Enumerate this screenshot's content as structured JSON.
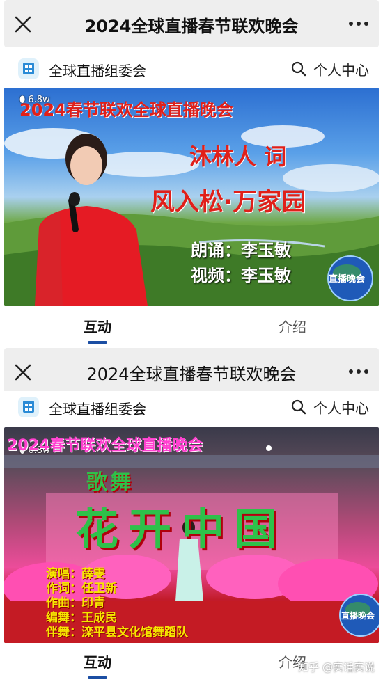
{
  "panels": [
    {
      "window_title": "2024全球直播春节联欢晚会",
      "account_name": "全球直播组委会",
      "personal_center": "个人中心",
      "video": {
        "views": "6.8w",
        "banner": "2024春节联欢全球直播晚会",
        "author": "沐林人 词",
        "work": "风入松·万家园",
        "credits": [
          "朗诵：李玉敏",
          "视频：李玉敏"
        ],
        "badge": "直播晚会"
      },
      "tabs": [
        "互动",
        "介绍"
      ]
    },
    {
      "window_title": "2024全球直播春节联欢晚会",
      "account_name": "全球直播组委会",
      "personal_center": "个人中心",
      "video": {
        "views": "6.8w",
        "banner": "2024春节联欢全球直播晚会",
        "genre": "歌舞",
        "work": "花开中国",
        "credits": [
          "演唱：薛雯",
          "作词：任卫新",
          "作曲：印青",
          "编舞：王成民",
          "伴舞：滦平县文化馆舞蹈队"
        ],
        "badge": "直播晚会"
      },
      "tabs": [
        "互动",
        "介绍"
      ],
      "watermark": "知乎 @实话实说"
    }
  ],
  "colors": {
    "topbar_bg": "#eeeeee",
    "tab_underline": "#1b4ea3",
    "title_red": "#e0201a",
    "pink_text": "#ff3fd0",
    "green_title": "#2ec14a"
  },
  "icons": [
    "close-icon",
    "more-icon",
    "account-logo-icon",
    "search-icon",
    "views-icon",
    "globe-badge-icon"
  ]
}
